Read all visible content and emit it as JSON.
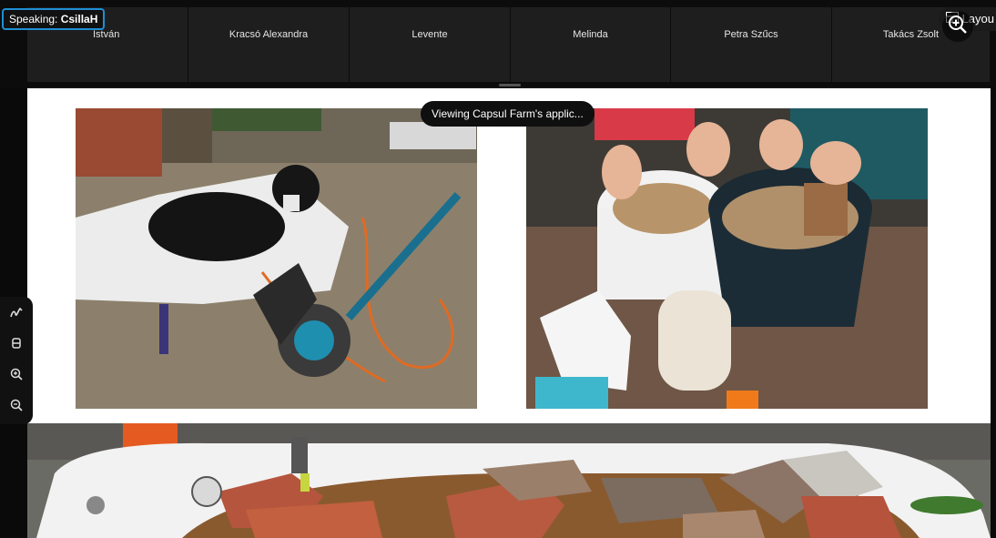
{
  "speaking": {
    "prefix": "Speaking:",
    "name": "CsillaH"
  },
  "participants": [
    "István",
    "Kracsó Alexandra",
    "Levente",
    "Melinda",
    "Petra Szűcs",
    "Takács Zsolt"
  ],
  "layout_button": {
    "label": "Layou"
  },
  "viewing_banner": "Viewing Capsul Farm's applic...",
  "toolbar": [
    {
      "icon": "pen-icon"
    },
    {
      "icon": "eraser-icon"
    },
    {
      "icon": "zoom-in-icon"
    },
    {
      "icon": "zoom-out-icon"
    }
  ],
  "colors": {
    "accent": "#1f8fd4",
    "tile": "#1e1e1e",
    "background": "#0c0c0c"
  }
}
